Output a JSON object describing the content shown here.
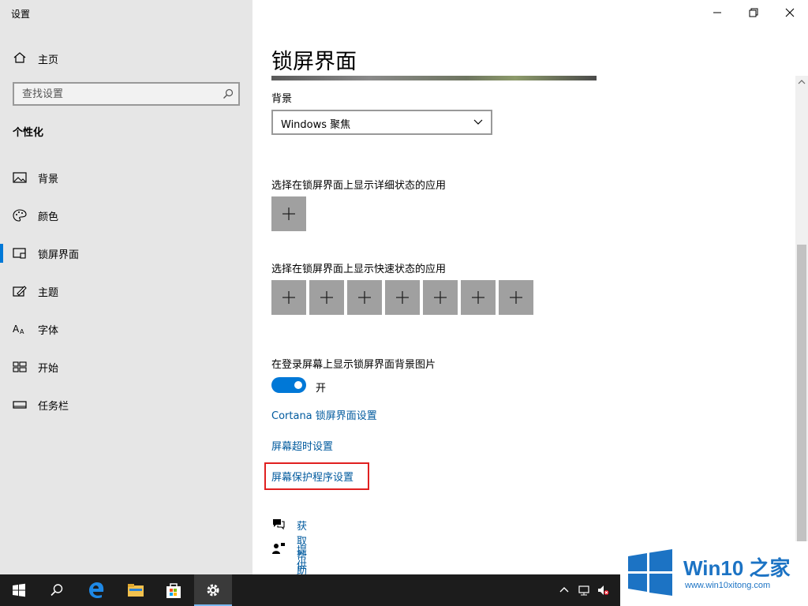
{
  "window": {
    "app_title": "设置"
  },
  "sidebar": {
    "home_label": "主页",
    "search_placeholder": "查找设置",
    "section_heading": "个性化",
    "items": [
      {
        "label": "背景",
        "icon": "image-icon"
      },
      {
        "label": "颜色",
        "icon": "palette-icon"
      },
      {
        "label": "锁屏界面",
        "icon": "lock-screen-icon",
        "active": true
      },
      {
        "label": "主题",
        "icon": "theme-brush-icon"
      },
      {
        "label": "字体",
        "icon": "font-icon"
      },
      {
        "label": "开始",
        "icon": "start-tiles-icon"
      },
      {
        "label": "任务栏",
        "icon": "taskbar-icon"
      }
    ]
  },
  "main": {
    "page_title": "锁屏界面",
    "background_label": "背景",
    "background_value": "Windows 聚焦",
    "detail_status_label": "选择在锁屏界面上显示详细状态的应用",
    "quick_status_label": "选择在锁屏界面上显示快速状态的应用",
    "login_bg_label": "在登录屏幕上显示锁屏界面背景图片",
    "toggle_state": "开",
    "links": {
      "cortana": "Cortana 锁屏界面设置",
      "timeout": "屏幕超时设置",
      "screensaver": "屏幕保护程序设置"
    },
    "help": {
      "get_help": "获取帮助",
      "feedback": "提供反馈"
    }
  },
  "colors": {
    "accent": "#0078d7",
    "link": "#005a9e",
    "highlight_box": "#e02020",
    "sidebar_bg": "#e6e6e6",
    "taskbar_bg": "#1c1c1c"
  },
  "watermark": {
    "title": "Win10 之家",
    "url": "www.win10xitong.com"
  }
}
